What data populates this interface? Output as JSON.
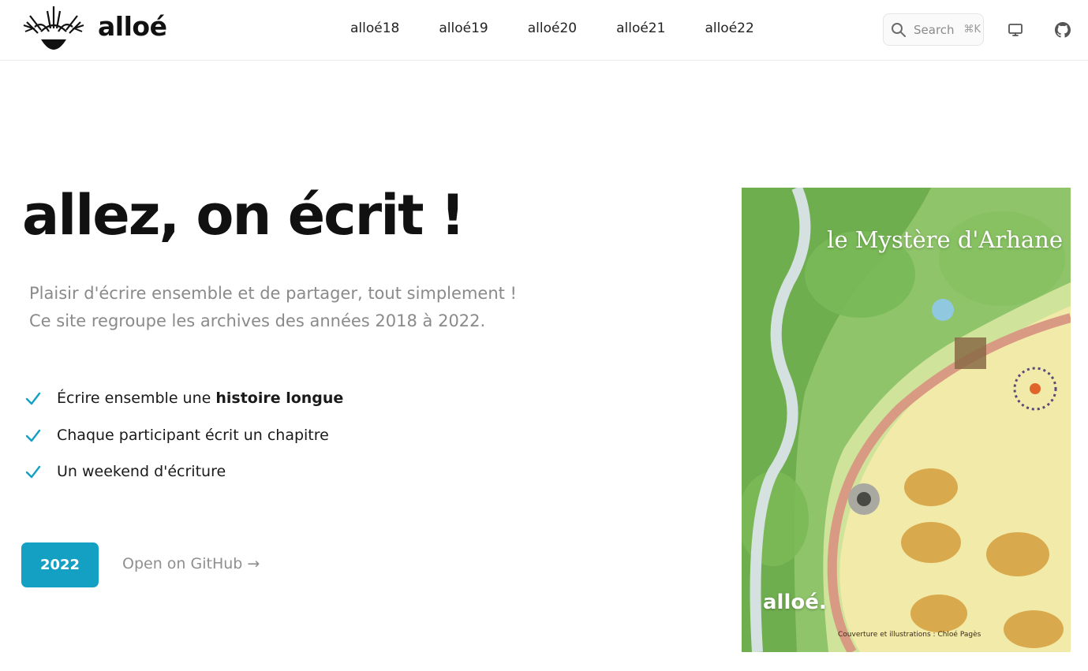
{
  "header": {
    "brand": "alloé",
    "nav": [
      "alloé18",
      "alloé19",
      "alloé20",
      "alloé21",
      "alloé22"
    ],
    "search": {
      "placeholder": "Search",
      "shortcut": "⌘K"
    },
    "icons": [
      "logo-icon",
      "search-icon",
      "monitor-icon",
      "github-icon"
    ]
  },
  "hero": {
    "title": "allez, on écrit !",
    "subtitle_lines": [
      "Plaisir d'écrire ensemble et de partager, tout simplement !",
      "Ce site regroupe les archives des années 2018 à 2022."
    ],
    "features": [
      {
        "text": "Écrire ensemble une",
        "bold": "histoire longue"
      },
      {
        "text": "Chaque participant écrit un chapitre",
        "bold": ""
      },
      {
        "text": "Un weekend d'écriture",
        "bold": ""
      }
    ],
    "primary_button": "2022",
    "secondary_link": "Open on GitHub →"
  },
  "cover": {
    "title": "le Mystère d'Arhane",
    "brand": "alloé.",
    "credit": "Couverture et illustrations : Chloé Pagès"
  },
  "colors": {
    "accent": "#14a0c2",
    "text": "#111111",
    "muted": "#8a8a8a"
  }
}
